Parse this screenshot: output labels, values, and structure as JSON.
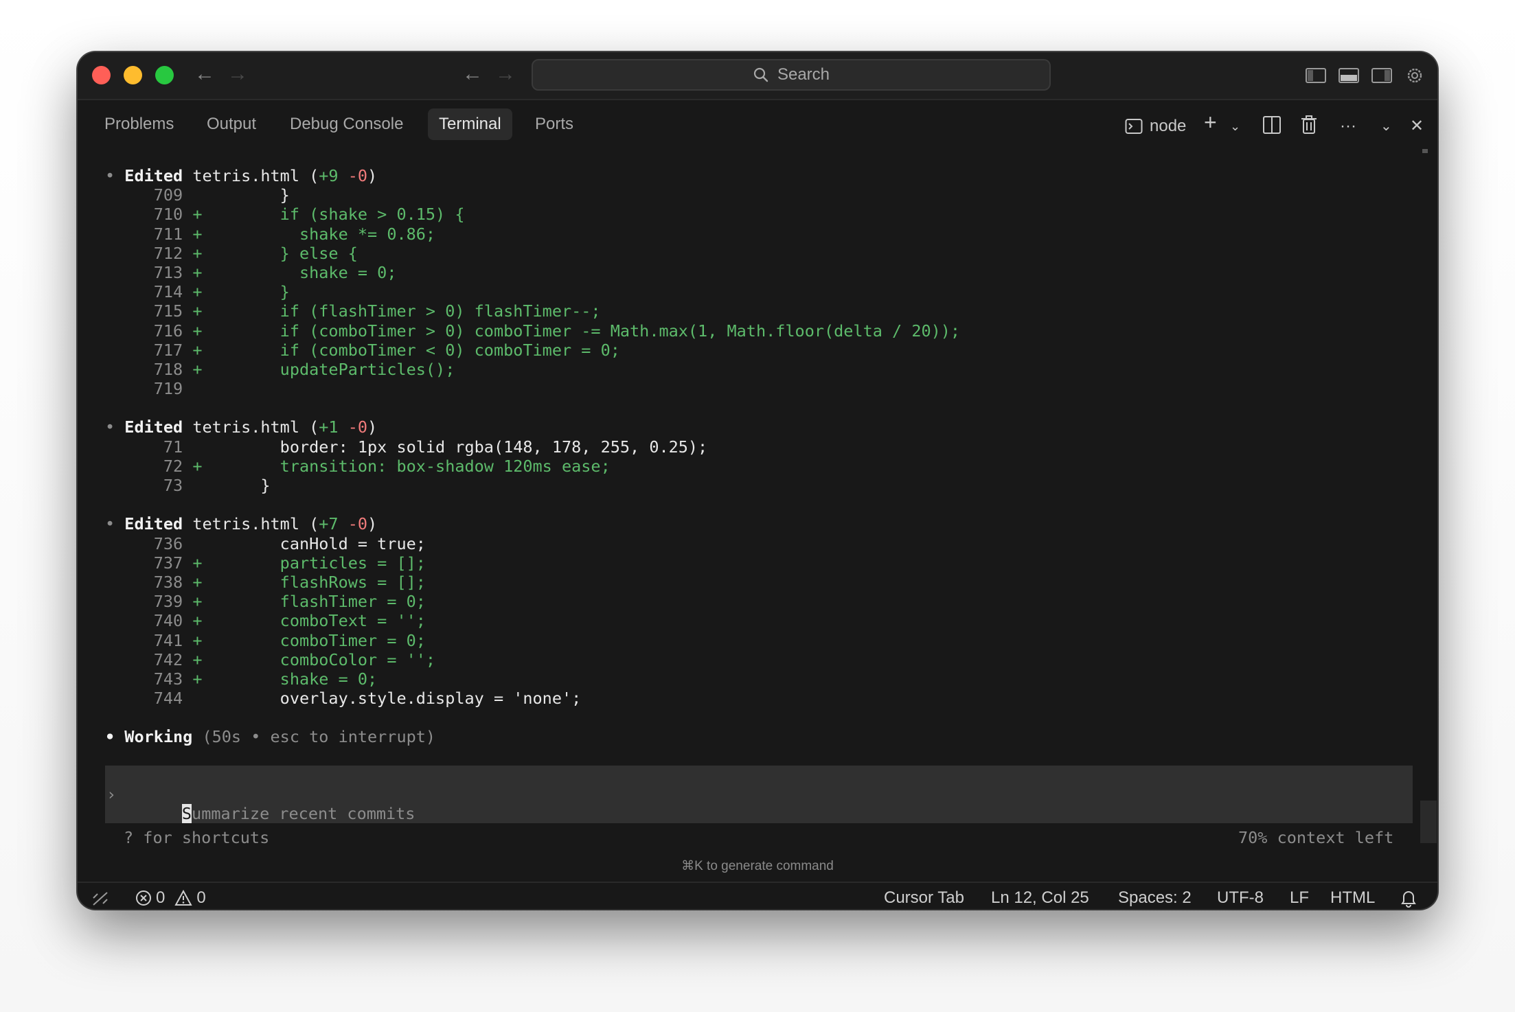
{
  "titlebar": {
    "search_placeholder": "Search",
    "nav_back_icon": "arrow-left-icon",
    "nav_forward_icon": "arrow-right-icon"
  },
  "panel": {
    "tabs": [
      "Problems",
      "Output",
      "Debug Console",
      "Terminal",
      "Ports"
    ],
    "active_tab": "Terminal",
    "terminal_name": "node"
  },
  "terminal": {
    "blocks": [
      {
        "file": "tetris.html",
        "added": "+9",
        "removed": "-0",
        "lines": [
          {
            "num": "709",
            "mark": " ",
            "code": "      }"
          },
          {
            "num": "710",
            "mark": "+",
            "code": "      if (shake > 0.15) {"
          },
          {
            "num": "711",
            "mark": "+",
            "code": "        shake *= 0.86;"
          },
          {
            "num": "712",
            "mark": "+",
            "code": "      } else {"
          },
          {
            "num": "713",
            "mark": "+",
            "code": "        shake = 0;"
          },
          {
            "num": "714",
            "mark": "+",
            "code": "      }"
          },
          {
            "num": "715",
            "mark": "+",
            "code": "      if (flashTimer > 0) flashTimer--;"
          },
          {
            "num": "716",
            "mark": "+",
            "code": "      if (comboTimer > 0) comboTimer -= Math.max(1, Math.floor(delta / 20));"
          },
          {
            "num": "717",
            "mark": "+",
            "code": "      if (comboTimer < 0) comboTimer = 0;"
          },
          {
            "num": "718",
            "mark": "+",
            "code": "      updateParticles();"
          },
          {
            "num": "719",
            "mark": " ",
            "code": ""
          }
        ]
      },
      {
        "file": "tetris.html",
        "added": "+1",
        "removed": "-0",
        "lines": [
          {
            "num": "71",
            "mark": " ",
            "code": "      border: 1px solid rgba(148, 178, 255, 0.25);"
          },
          {
            "num": "72",
            "mark": "+",
            "code": "      transition: box-shadow 120ms ease;"
          },
          {
            "num": "73",
            "mark": " ",
            "code": "    }"
          }
        ]
      },
      {
        "file": "tetris.html",
        "added": "+7",
        "removed": "-0",
        "lines": [
          {
            "num": "736",
            "mark": " ",
            "code": "      canHold = true;"
          },
          {
            "num": "737",
            "mark": "+",
            "code": "      particles = [];"
          },
          {
            "num": "738",
            "mark": "+",
            "code": "      flashRows = [];"
          },
          {
            "num": "739",
            "mark": "+",
            "code": "      flashTimer = 0;"
          },
          {
            "num": "740",
            "mark": "+",
            "code": "      comboText = '';"
          },
          {
            "num": "741",
            "mark": "+",
            "code": "      comboTimer = 0;"
          },
          {
            "num": "742",
            "mark": "+",
            "code": "      comboColor = '';"
          },
          {
            "num": "743",
            "mark": "+",
            "code": "      shake = 0;"
          },
          {
            "num": "744",
            "mark": " ",
            "code": "      overlay.style.display = 'none';"
          }
        ]
      }
    ],
    "edited_label": "Edited",
    "working_label": "Working",
    "working_detail": "(50s • esc to interrupt)",
    "prompt_char": "›",
    "input_placeholder": "Summarize recent commits",
    "shortcuts_hint": "? for shortcuts",
    "context_left": "70% context left",
    "generate_hint": "⌘K to generate command"
  },
  "statusbar": {
    "errors": "0",
    "warnings": "0",
    "cursor_tab": "Cursor Tab",
    "position": "Ln 12, Col 25",
    "spaces": "Spaces: 2",
    "encoding": "UTF-8",
    "eol": "LF",
    "language": "HTML"
  },
  "colors": {
    "added": "#5dbb6b",
    "removed": "#f07b7b",
    "background": "#181818"
  }
}
